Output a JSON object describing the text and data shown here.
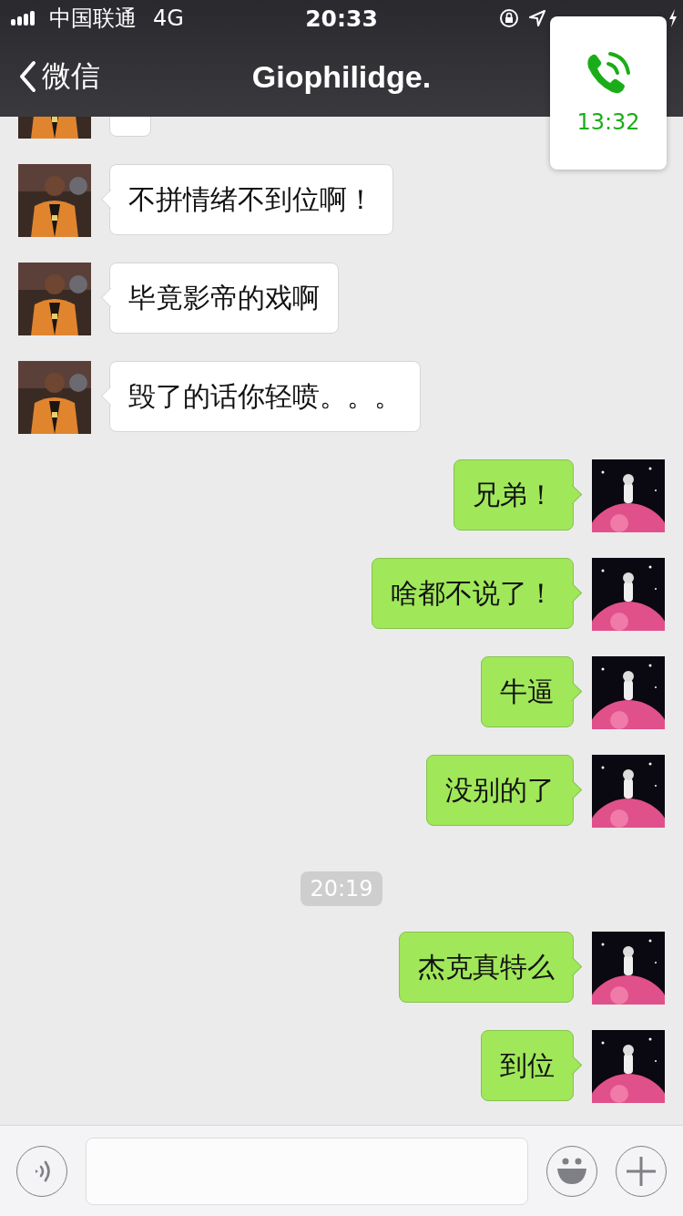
{
  "status_bar": {
    "carrier": "中国联通",
    "network": "4G",
    "time": "20:33"
  },
  "nav": {
    "back": "微信",
    "title": "Giophilidge."
  },
  "call_widget": {
    "duration": "13:32"
  },
  "messages": [
    {
      "kind": "incoming"
    },
    {
      "kind": "incoming",
      "text": "不拼情绪不到位啊！"
    },
    {
      "kind": "incoming",
      "text": "毕竟影帝的戏啊"
    },
    {
      "kind": "incoming",
      "text": "毁了的话你轻喷。。。"
    },
    {
      "kind": "outgoing",
      "text": "兄弟！"
    },
    {
      "kind": "outgoing",
      "text": "啥都不说了！"
    },
    {
      "kind": "outgoing",
      "text": "牛逼"
    },
    {
      "kind": "outgoing",
      "text": "没别的了"
    },
    {
      "kind": "time",
      "text": "20:19"
    },
    {
      "kind": "outgoing",
      "text": "杰克真特么"
    },
    {
      "kind": "outgoing",
      "text": "到位"
    }
  ]
}
